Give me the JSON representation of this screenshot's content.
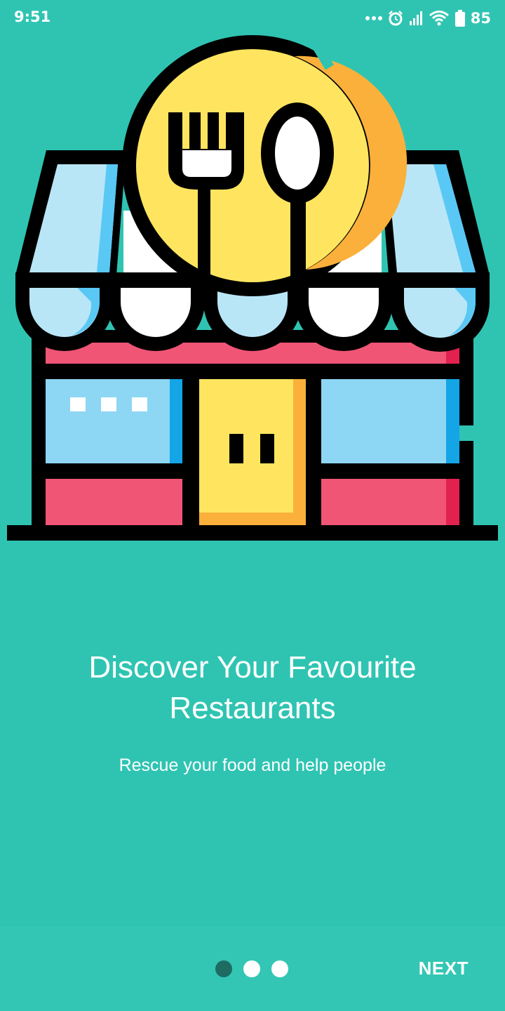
{
  "status_bar": {
    "time": "9:51",
    "battery_level": "85",
    "icons": [
      "more-dots-icon",
      "alarm-icon",
      "signal-icon",
      "wifi-icon",
      "battery-icon"
    ]
  },
  "onboarding": {
    "illustration": "restaurant-storefront-icon",
    "title_line1": "Discover Your Favourite",
    "title_line2": "Restaurants",
    "subtitle": "Rescue your food and help people"
  },
  "pager": {
    "pages": 3,
    "current_page": 1
  },
  "bottom_bar": {
    "next_label": "NEXT"
  },
  "colors": {
    "background": "#2fc4b2",
    "active_dot": "#1e6b62",
    "awning_blue": "#b9e6f7",
    "wall_red": "#f05576",
    "door_yellow": "#ffe55f"
  }
}
